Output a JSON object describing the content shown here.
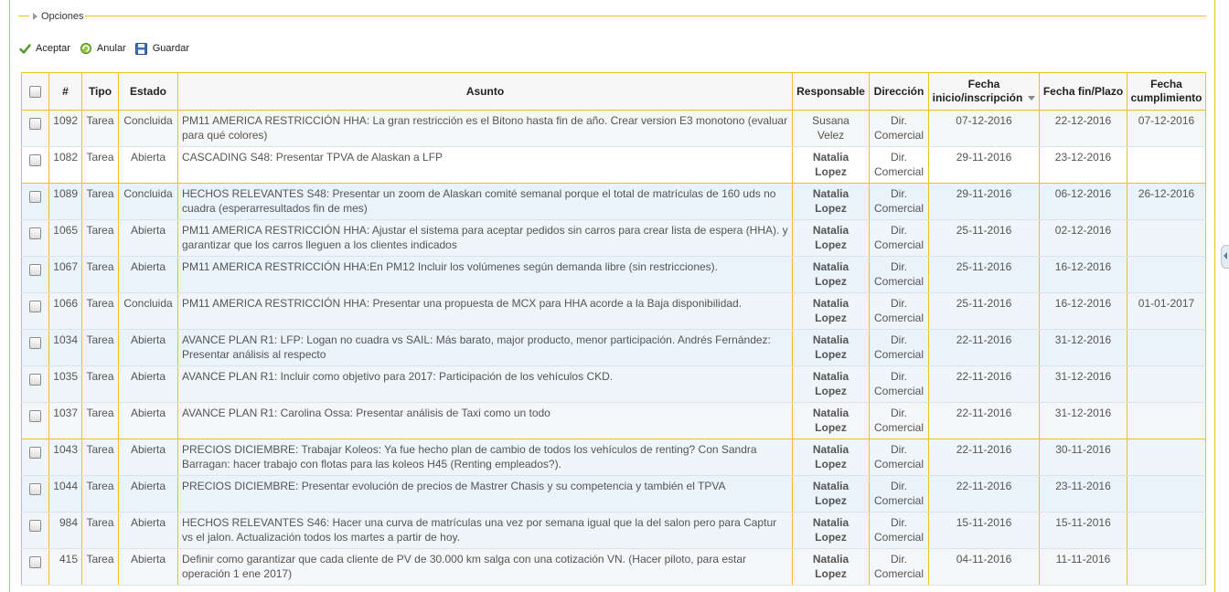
{
  "options": {
    "label": "Opciones"
  },
  "toolbar": {
    "accept": "Aceptar",
    "cancel": "Anular",
    "save": "Guardar"
  },
  "colors": {
    "border": "#f0c020",
    "link": "#3a6fa8"
  },
  "columns": {
    "num": "#",
    "tipo": "Tipo",
    "estado": "Estado",
    "asunto": "Asunto",
    "responsable": "Responsable",
    "direccion": "Dirección",
    "fecha_inicio_1": "Fecha",
    "fecha_inicio_2": "inicio/inscripción",
    "fecha_fin": "Fecha fin/Plazo",
    "fecha_cump_1": "Fecha",
    "fecha_cump_2": "cumplimiento"
  },
  "rows": [
    {
      "id": "1092",
      "tipo": "Tarea",
      "estado": "Concluida",
      "asunto": "PM11 AMERICA RESTRICCIÓN HHA: La gran restricción es el Bitono hasta fin de año. Crear version E3 monotono (evaluar para qué colores)",
      "resp1": "Susana",
      "resp2": "Velez",
      "dir1": "Dir.",
      "dir2": "Comercial",
      "inicio": "07-12-2016",
      "fin": "22-12-2016",
      "cump": "07-12-2016"
    },
    {
      "id": "1082",
      "tipo": "Tarea",
      "estado": "Abierta",
      "asunto": "CASCADING S48: Presentar TPVA de Alaskan a LFP",
      "resp1": "Natalia",
      "resp2": "Lopez",
      "dir1": "Dir.",
      "dir2": "Comercial",
      "inicio": "29-11-2016",
      "fin": "23-12-2016",
      "cump": ""
    },
    {
      "id": "1089",
      "tipo": "Tarea",
      "estado": "Concluida",
      "asunto": "HECHOS RELEVANTES S48: Presentar un zoom de Alaskan comité semanal porque el total de matrículas de 160 uds no cuadra (esperarresultados fin de mes)",
      "resp1": "Natalia",
      "resp2": "Lopez",
      "dir1": "Dir.",
      "dir2": "Comercial",
      "inicio": "29-11-2016",
      "fin": "06-12-2016",
      "cump": "26-12-2016"
    },
    {
      "id": "1065",
      "tipo": "Tarea",
      "estado": "Abierta",
      "asunto": "PM11 AMERICA RESTRICCIÓN HHA: Ajustar el sistema para aceptar pedidos sin carros para crear lista de espera (HHA). y garantizar que los carros lleguen a los clientes indicados",
      "resp1": "Natalia",
      "resp2": "Lopez",
      "dir1": "Dir.",
      "dir2": "Comercial",
      "inicio": "25-11-2016",
      "fin": "02-12-2016",
      "cump": ""
    },
    {
      "id": "1067",
      "tipo": "Tarea",
      "estado": "Abierta",
      "asunto": "PM11 AMERICA RESTRICCIÓN HHA:En PM12 Incluir los volúmenes según demanda libre (sin restricciones).",
      "resp1": "Natalia",
      "resp2": "Lopez",
      "dir1": "Dir.",
      "dir2": "Comercial",
      "inicio": "25-11-2016",
      "fin": "16-12-2016",
      "cump": ""
    },
    {
      "id": "1066",
      "tipo": "Tarea",
      "estado": "Concluida",
      "asunto": "PM11 AMERICA RESTRICCIÓN HHA: Presentar una propuesta de MCX para HHA acorde a la Baja disponibilidad.",
      "resp1": "Natalia",
      "resp2": "Lopez",
      "dir1": "Dir.",
      "dir2": "Comercial",
      "inicio": "25-11-2016",
      "fin": "16-12-2016",
      "cump": "01-01-2017"
    },
    {
      "id": "1034",
      "tipo": "Tarea",
      "estado": "Abierta",
      "asunto": "AVANCE PLAN R1: LFP: Logan no cuadra vs SAIL: Más barato, major producto, menor participación. Andrés Fernández: Presentar análisis al respecto",
      "resp1": "Natalia",
      "resp2": "Lopez",
      "dir1": "Dir.",
      "dir2": "Comercial",
      "inicio": "22-11-2016",
      "fin": "31-12-2016",
      "cump": ""
    },
    {
      "id": "1035",
      "tipo": "Tarea",
      "estado": "Abierta",
      "asunto": "AVANCE PLAN R1: Incluir como objetivo para 2017: Participación de los vehículos CKD.",
      "resp1": "Natalia",
      "resp2": "Lopez",
      "dir1": "Dir.",
      "dir2": "Comercial",
      "inicio": "22-11-2016",
      "fin": "31-12-2016",
      "cump": ""
    },
    {
      "id": "1037",
      "tipo": "Tarea",
      "estado": "Abierta",
      "asunto": "AVANCE PLAN R1: Carolina Ossa: Presentar análisis de Taxi como un todo",
      "resp1": "Natalia",
      "resp2": "Lopez",
      "dir1": "Dir.",
      "dir2": "Comercial",
      "inicio": "22-11-2016",
      "fin": "31-12-2016",
      "cump": ""
    },
    {
      "id": "1043",
      "tipo": "Tarea",
      "estado": "Abierta",
      "asunto": "PRECIOS DICIEMBRE: Trabajar Koleos: Ya fue hecho plan de cambio de todos los vehículos de renting? Con Sandra Barragan: hacer trabajo con flotas para las koleos H45 (Renting empleados?).",
      "resp1": "Natalia",
      "resp2": "Lopez",
      "dir1": "Dir.",
      "dir2": "Comercial",
      "inicio": "22-11-2016",
      "fin": "30-11-2016",
      "cump": ""
    },
    {
      "id": "1044",
      "tipo": "Tarea",
      "estado": "Abierta",
      "asunto": "PRECIOS DICIEMBRE: Presentar evolución de precios de Mastrer Chasis y su competencia y también el TPVA",
      "resp1": "Natalia",
      "resp2": "Lopez",
      "dir1": "Dir.",
      "dir2": "Comercial",
      "inicio": "22-11-2016",
      "fin": "23-11-2016",
      "cump": ""
    },
    {
      "id": "984",
      "tipo": "Tarea",
      "estado": "Abierta",
      "asunto": "HECHOS RELEVANTES S46: Hacer una curva de matrículas una vez por semana igual que la del salon pero para Captur vs el jalon. Actualización todos los martes a partir de hoy.",
      "resp1": "Natalia",
      "resp2": "Lopez",
      "dir1": "Dir.",
      "dir2": "Comercial",
      "inicio": "15-11-2016",
      "fin": "15-11-2016",
      "cump": ""
    },
    {
      "id": "415",
      "tipo": "Tarea",
      "estado": "Abierta",
      "asunto": "Definir como garantizar que cada cliente de PV de 30.000 km salga con una cotización VN. (Hacer piloto, para estar operación 1 ene 2017)",
      "resp1": "Natalia",
      "resp2": "Lopez",
      "dir1": "Dir.",
      "dir2": "Comercial",
      "inicio": "04-11-2016",
      "fin": "11-11-2016",
      "cump": ""
    }
  ]
}
